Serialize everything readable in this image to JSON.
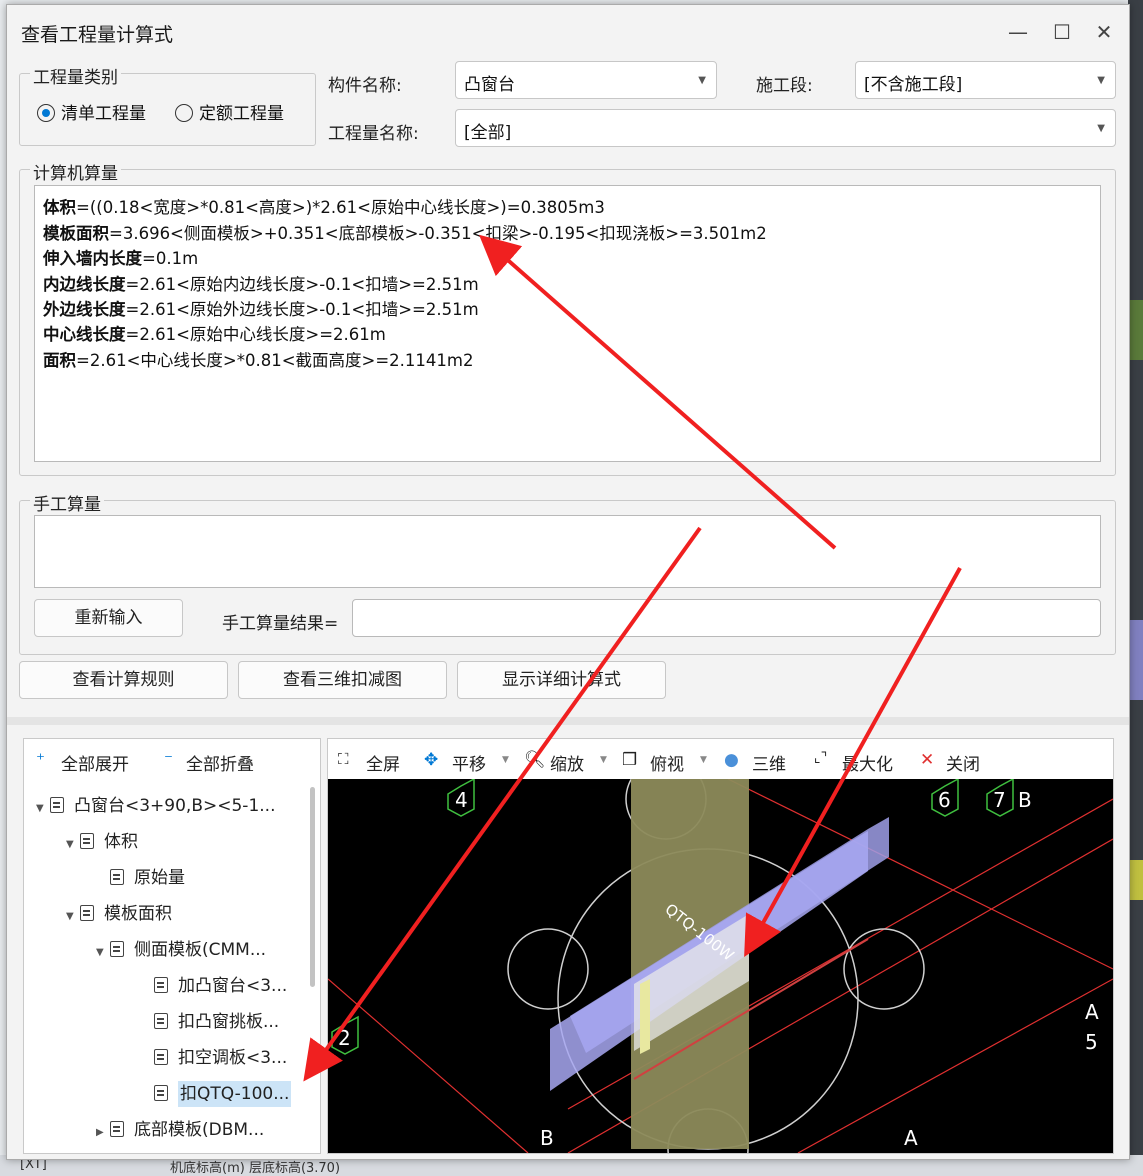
{
  "dialog": {
    "title": "查看工程量计算式",
    "minimize": "—",
    "maximize": "☐",
    "close": "✕"
  },
  "quantity_type": {
    "legend": "工程量类别",
    "options": [
      "清单工程量",
      "定额工程量"
    ],
    "selected": "清单工程量"
  },
  "component": {
    "label": "构件名称:",
    "value": "凸窗台"
  },
  "stage": {
    "label": "施工段:",
    "value": "[不含施工段]"
  },
  "quantity_name": {
    "label": "工程量名称:",
    "value": "[全部]"
  },
  "computer_calc": {
    "legend": "计算机算量",
    "lines": [
      {
        "name": "体积",
        "expr": "=((0.18<宽度>*0.81<高度>)*2.61<原始中心线长度>)=0.3805m3"
      },
      {
        "name": "模板面积",
        "expr": "=3.696<侧面模板>+0.351<底部模板>-0.351<扣梁>-0.195<扣现浇板>=3.501m2"
      },
      {
        "name": "伸入墙内长度",
        "expr": "=0.1m"
      },
      {
        "name": "内边线长度",
        "expr": "=2.61<原始内边线长度>-0.1<扣墙>=2.51m"
      },
      {
        "name": "外边线长度",
        "expr": "=2.61<原始外边线长度>-0.1<扣墙>=2.51m"
      },
      {
        "name": "中心线长度",
        "expr": "=2.61<原始中心线长度>=2.61m"
      },
      {
        "name": "面积",
        "expr": "=2.61<中心线长度>*0.81<截面高度>=2.1141m2"
      }
    ]
  },
  "manual_calc": {
    "legend": "手工算量",
    "reenter_button": "重新输入",
    "result_label": "手工算量结果=",
    "result_value": ""
  },
  "actions": {
    "view_rules": "查看计算规则",
    "view_3d_deduct": "查看三维扣减图",
    "show_detail": "显示详细计算式"
  },
  "tree_toolbar": {
    "expand_all": "全部展开",
    "collapse_all": "全部折叠"
  },
  "tree": [
    {
      "label": "凸窗台<3+90,B><5-1...",
      "arrow": "▼"
    },
    {
      "label": "体积",
      "arrow": "▼"
    },
    {
      "label": "原始量",
      "arrow": ""
    },
    {
      "label": "模板面积",
      "arrow": "▼"
    },
    {
      "label": "侧面模板(CMM...",
      "arrow": "▼"
    },
    {
      "label": "加凸窗台<3...",
      "arrow": ""
    },
    {
      "label": "扣凸窗挑板...",
      "arrow": ""
    },
    {
      "label": "扣空调板<3...",
      "arrow": ""
    },
    {
      "label": "扣QTQ-100...",
      "arrow": "",
      "selected": true
    },
    {
      "label": "底部模板(DBM...",
      "arrow": "▶"
    }
  ],
  "view_toolbar": {
    "fullscreen": "全屏",
    "pan": "平移",
    "zoom": "缩放",
    "top_view": "俯视",
    "three_d": "三维",
    "maximize": "最大化",
    "close": "关闭"
  },
  "canvas": {
    "axis_labels": [
      "4",
      "6",
      "7",
      "B",
      "A",
      "5",
      "2",
      "B",
      "A"
    ],
    "element_label": "QTQ-100W"
  },
  "background": {
    "bottom_text": "机底标高(m) 层底标高(3.70)",
    "bottom_left": "[XT]"
  }
}
